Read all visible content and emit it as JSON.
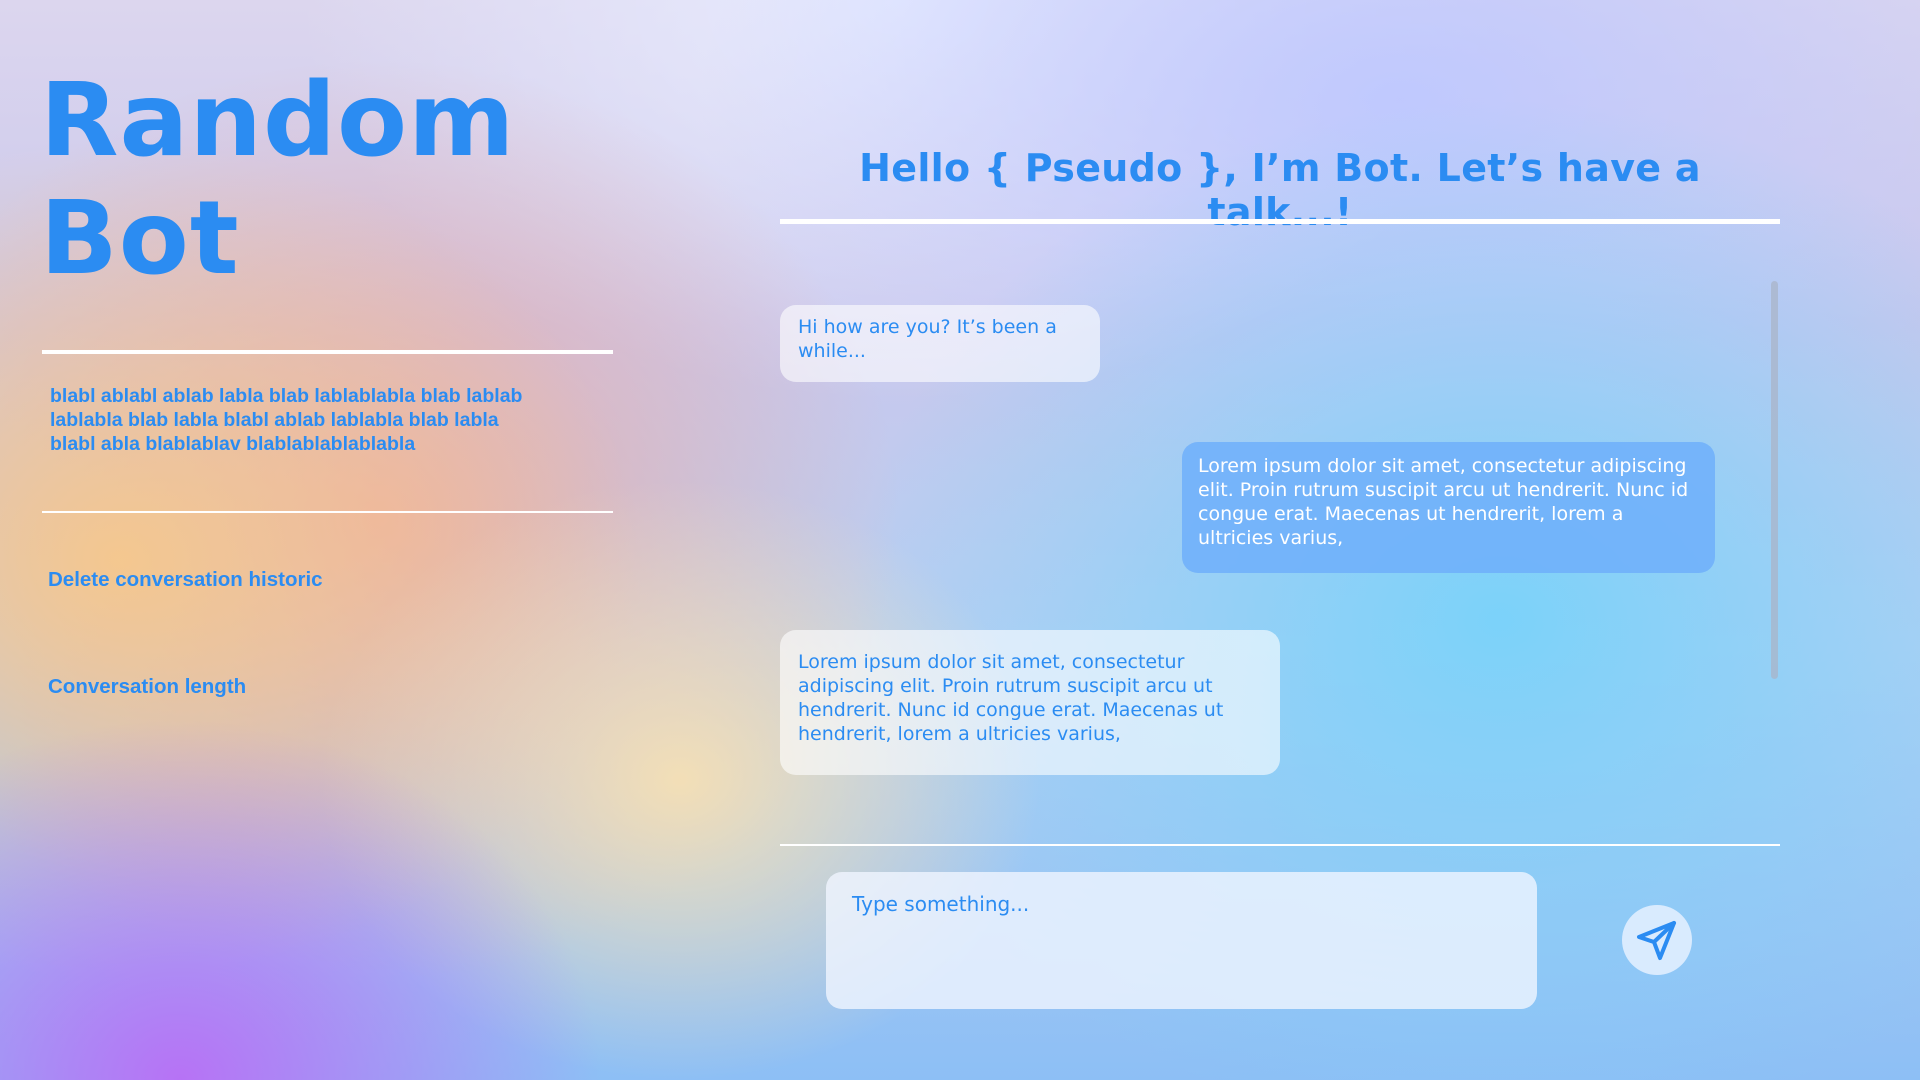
{
  "sidebar": {
    "title": "Random\nBot",
    "intro": "blabl ablabl ablab labla blab lablablabla blab lablab\nlablabla blab labla  blabl ablab  lablabla blab labla\nblabl abla blablablav blablablablablabla",
    "actions": {
      "delete_label": "Delete conversation historic",
      "length_label": "Conversation length"
    }
  },
  "chat": {
    "header": "Hello { Pseudo }, I’m Bot. Let’s have a talk...!",
    "messages": [
      {
        "sender": "bot",
        "text": "Hi how are you? It’s been a while..."
      },
      {
        "sender": "user",
        "text": "Lorem ipsum dolor sit amet, consectetur adipiscing elit. Proin rutrum suscipit arcu ut hendrerit. Nunc id congue erat. Maecenas ut hendrerit, lorem a ultricies varius,"
      },
      {
        "sender": "bot",
        "text": "Lorem ipsum dolor sit amet, consectetur adipiscing elit. Proin rutrum suscipit arcu ut hendrerit. Nunc id congue erat. Maecenas ut hendrerit, lorem a ultricies varius,"
      }
    ],
    "input": {
      "placeholder": "Type something...",
      "value": ""
    },
    "send_icon": "send-paper-plane-icon"
  },
  "colors": {
    "accent": "#2b8cf2",
    "user_bubble": "#6eaffa",
    "divider": "#ffffff"
  }
}
